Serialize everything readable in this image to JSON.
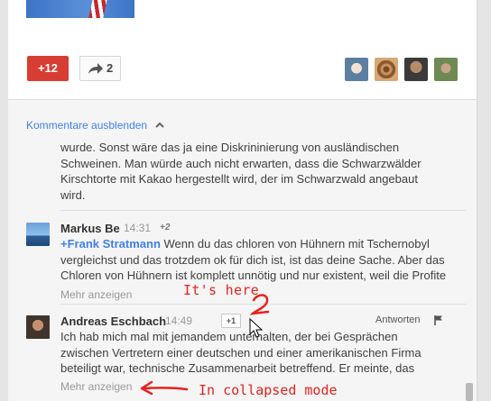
{
  "post": {
    "plus_count": "+12",
    "share_count": "2",
    "plusers": [
      "plus-one-user-1",
      "plus-one-user-2",
      "plus-one-user-3",
      "plus-one-user-4"
    ]
  },
  "comments": {
    "hide_label": "Kommentare ausblenden",
    "partial": {
      "lines": [
        "wurde. Sonst wäre das ja eine Diskrininierung von ausländischen",
        "Schweinen. Man würde auch nicht erwarten, dass die Schwarzwälder",
        "Kirschtorte mit Kakao hergestellt wird, der im Schwarzwald angebaut",
        "wird."
      ]
    },
    "items": [
      {
        "author": "Markus Be",
        "time": "14:31",
        "plus": "+2",
        "mention": "+Frank Stratmann",
        "line1": " Wenn du das chloren von Hühnern mit Tschernobyl",
        "line2": "vergleichst und das trotzdem ok für dich ist, ist das deine Sache. Aber das",
        "line3": "Chloren von Hühnern ist komplett unnötig und nur existent, weil die Profite",
        "more": "Mehr anzeigen"
      },
      {
        "author": "Andreas Eschbach",
        "time": "14:49",
        "plus_button": "+1",
        "reply": "Antworten",
        "line1": "Ich hab mich mal mit jemandem unterhalten, der bei Gesprächen",
        "line2": "zwischen Vertretern einer deutschen und einer amerikanischen Firma",
        "line3": "beteiligt war, technische Zusammenarbeit betreffend. Er meinte, das",
        "more": "Mehr anzeigen"
      }
    ]
  },
  "annotations": {
    "pointer_note": "It's here",
    "collapsed_note": "In collapsed mode",
    "color": "#e8211d"
  }
}
